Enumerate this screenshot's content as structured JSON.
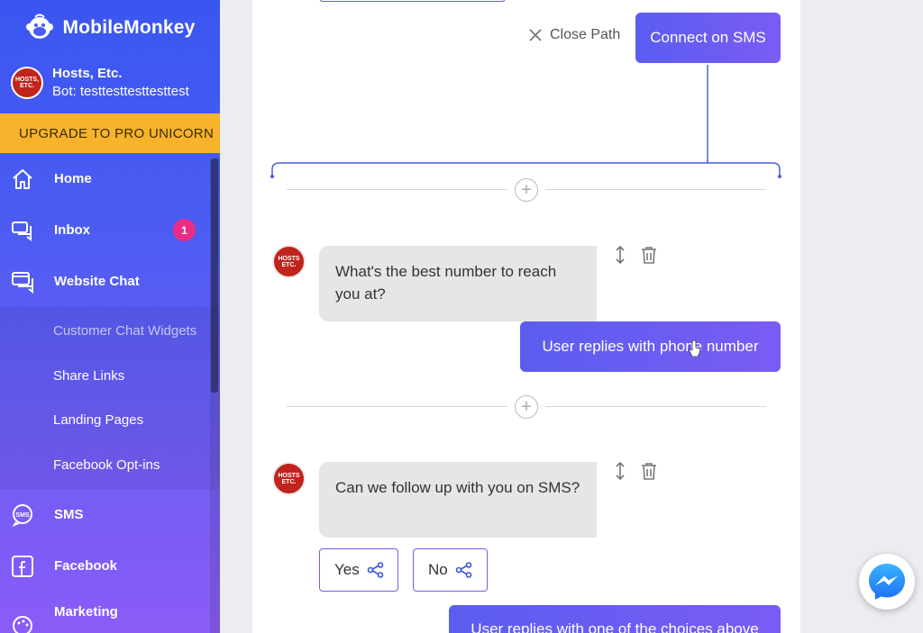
{
  "brand": {
    "name": "MobileMonkey"
  },
  "account": {
    "name": "Hosts, Etc.",
    "bot": "Bot: testtesttesttesttest",
    "avatar_text": "HOSTS, ETC."
  },
  "upgrade": {
    "label": "UPGRADE TO PRO UNICORN"
  },
  "nav": {
    "home": "Home",
    "inbox": "Inbox",
    "inbox_badge": "1",
    "website_chat": "Website Chat",
    "sub": [
      "Customer Chat Widgets",
      "Share Links",
      "Landing Pages",
      "Facebook Opt-ins"
    ],
    "sms": "SMS",
    "facebook": "Facebook",
    "marketing": "Marketing"
  },
  "editor": {
    "close_path": "Close Path",
    "connect_sms": "Connect on SMS",
    "q1": "What's the best number to reach you at?",
    "reply1": "User replies with phone number",
    "q2": "Can we follow up with you on SMS?",
    "choice_yes": "Yes",
    "choice_no": "No",
    "reply2": "User replies with one of the choices above"
  },
  "colors": {
    "accent": "#5b5df0",
    "upgrade": "#f7b32b",
    "badge": "#ea2d84"
  }
}
